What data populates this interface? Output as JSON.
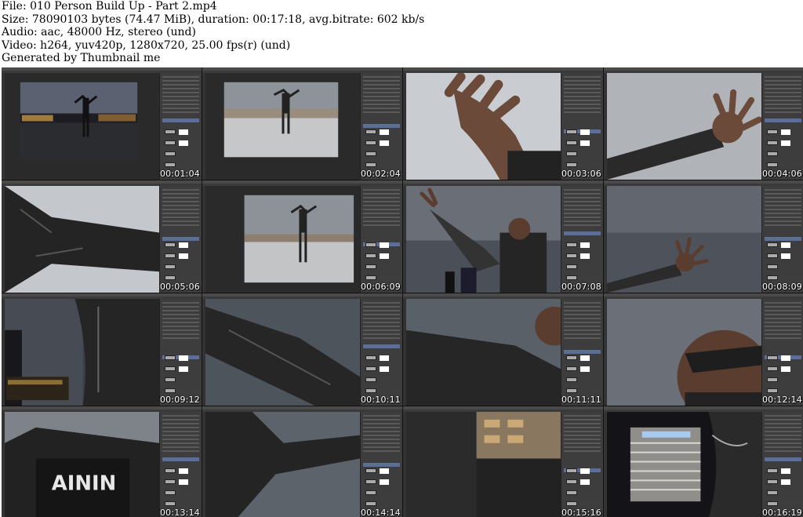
{
  "header": {
    "file_line": "File: 010 Person Build Up - Part 2.mp4",
    "size_line": "Size: 78090103 bytes (74.47 MiB), duration: 00:17:18, avg.bitrate: 602 kb/s",
    "audio_line": "Audio: aac, 48000 Hz, stereo (und)",
    "video_line": "Video: h264, yuv420p, 1280x720, 25.00 fps(r) (und)",
    "generator_line": "Generated by Thumbnail me"
  },
  "thumbnails": [
    {
      "timestamp": "00:01:04",
      "scene": "night-city-wide"
    },
    {
      "timestamp": "00:02:04",
      "scene": "day-rooftop-wide"
    },
    {
      "timestamp": "00:03:06",
      "scene": "hand-closeup-sky"
    },
    {
      "timestamp": "00:04:06",
      "scene": "arm-hand-sky"
    },
    {
      "timestamp": "00:05:06",
      "scene": "arm-jacket-closeup"
    },
    {
      "timestamp": "00:06:09",
      "scene": "day-rooftop-wide-2"
    },
    {
      "timestamp": "00:07:08",
      "scene": "stormy-sky-person"
    },
    {
      "timestamp": "00:08:09",
      "scene": "stormy-hand"
    },
    {
      "timestamp": "00:09:12",
      "scene": "jacket-city-night"
    },
    {
      "timestamp": "00:10:11",
      "scene": "arm-sleeve-sky"
    },
    {
      "timestamp": "00:11:11",
      "scene": "arm-sleeve-face"
    },
    {
      "timestamp": "00:12:14",
      "scene": "face-sunglasses"
    },
    {
      "timestamp": "00:13:14",
      "scene": "tshirt-closeup"
    },
    {
      "timestamp": "00:14:14",
      "scene": "jacket-sky"
    },
    {
      "timestamp": "00:15:16",
      "scene": "building-night"
    },
    {
      "timestamp": "00:16:19",
      "scene": "building-necklace"
    }
  ],
  "colors": {
    "background": "#ffffff",
    "grid_background": "#1b1b1b",
    "panel": "#3d3d3d",
    "stamp_text": "#ffffff"
  }
}
